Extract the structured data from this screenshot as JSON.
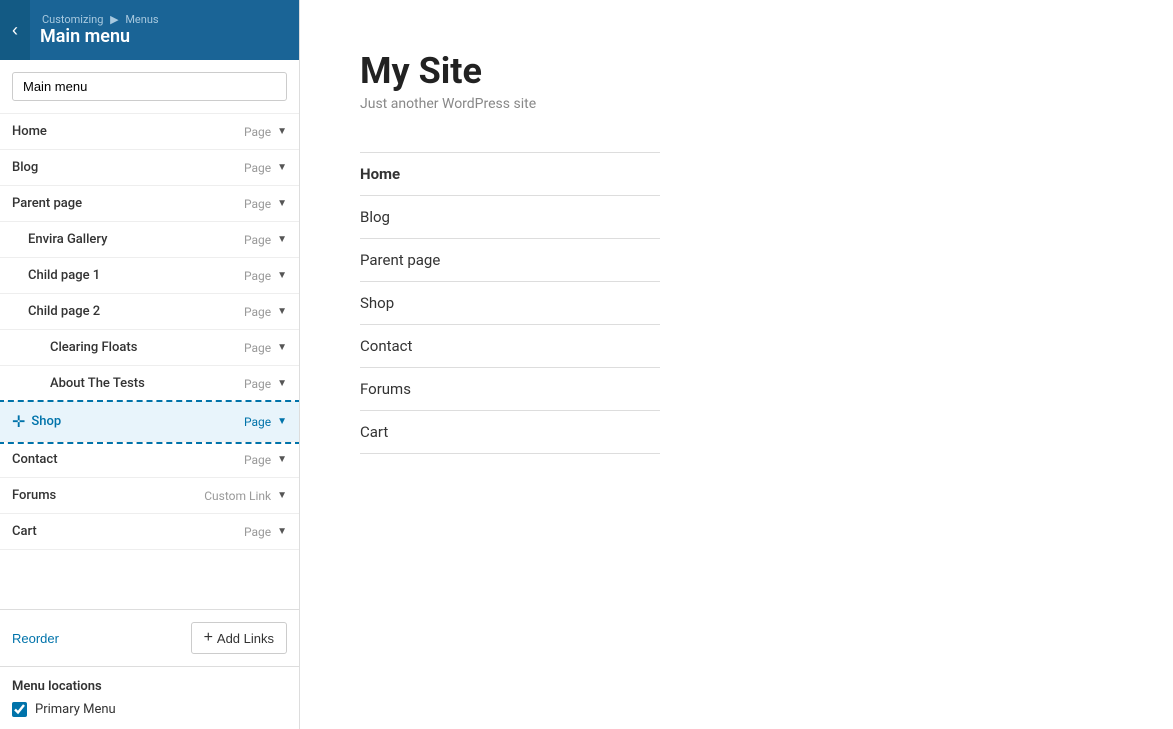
{
  "header": {
    "breadcrumb_part1": "Customizing",
    "breadcrumb_arrow": "▶",
    "breadcrumb_part2": "Menus",
    "main_title": "Main menu",
    "back_label": "‹"
  },
  "search": {
    "value": "Main menu",
    "placeholder": "Main menu"
  },
  "menu_items": [
    {
      "id": "home",
      "label": "Home",
      "type": "Page",
      "indent": 0,
      "highlighted": false
    },
    {
      "id": "blog",
      "label": "Blog",
      "type": "Page",
      "indent": 0,
      "highlighted": false
    },
    {
      "id": "parent-page",
      "label": "Parent page",
      "type": "Page",
      "indent": 0,
      "highlighted": false
    },
    {
      "id": "envira-gallery",
      "label": "Envira Gallery",
      "type": "Page",
      "indent": 1,
      "highlighted": false
    },
    {
      "id": "child-page-1",
      "label": "Child page 1",
      "type": "Page",
      "indent": 1,
      "highlighted": false
    },
    {
      "id": "child-page-2",
      "label": "Child page 2",
      "type": "Page",
      "indent": 1,
      "highlighted": false
    },
    {
      "id": "clearing-floats",
      "label": "Clearing Floats",
      "type": "Page",
      "indent": 2,
      "highlighted": false
    },
    {
      "id": "about-the-tests",
      "label": "About The Tests",
      "type": "Page",
      "indent": 2,
      "highlighted": false
    },
    {
      "id": "shop",
      "label": "Shop",
      "type": "Page",
      "indent": 0,
      "highlighted": true
    },
    {
      "id": "contact",
      "label": "Contact",
      "type": "Page",
      "indent": 0,
      "highlighted": false
    },
    {
      "id": "forums",
      "label": "Forums",
      "type": "Custom Link",
      "indent": 0,
      "highlighted": false
    },
    {
      "id": "cart",
      "label": "Cart",
      "type": "Page",
      "indent": 0,
      "highlighted": false
    }
  ],
  "footer": {
    "reorder_label": "Reorder",
    "add_links_label": "Add Links",
    "plus_symbol": "+"
  },
  "menu_locations": {
    "title": "Menu locations",
    "items": [
      {
        "id": "primary-menu",
        "label": "Primary Menu",
        "checked": true
      }
    ]
  },
  "preview": {
    "site_title": "My Site",
    "site_tagline": "Just another WordPress site",
    "nav_items": [
      {
        "id": "home",
        "label": "Home",
        "active": true
      },
      {
        "id": "blog",
        "label": "Blog",
        "active": false
      },
      {
        "id": "parent-page",
        "label": "Parent page",
        "active": false
      },
      {
        "id": "shop",
        "label": "Shop",
        "active": false
      },
      {
        "id": "contact",
        "label": "Contact",
        "active": false
      },
      {
        "id": "forums",
        "label": "Forums",
        "active": false
      },
      {
        "id": "cart",
        "label": "Cart",
        "active": false
      }
    ]
  }
}
